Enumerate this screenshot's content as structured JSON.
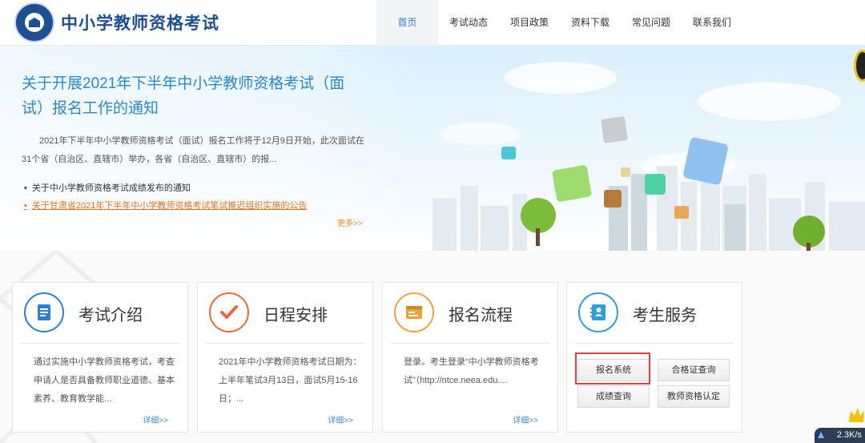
{
  "header": {
    "site_title": "中小学教师资格考试",
    "logo_icon": "exam-emblem-icon",
    "nav": [
      "首页",
      "考试动态",
      "项目政策",
      "资料下载",
      "常见问题",
      "联系我们"
    ],
    "active_nav": "首页"
  },
  "banner": {
    "title": "关于开展2021年下半年中小学教师资格考试（面试）报名工作的通知",
    "description": "2021年下半年中小学教师资格考试（面试）报名工作将于12月9日开始，此次面试在31个省（自治区、直辖市）举办，各省（自治区、直辖市）的报...",
    "news": [
      "关于中小学教师资格考试成绩发布的通知",
      "关于甘肃省2021年下半年中小学教师资格考试笔试推迟组织实施的公告"
    ],
    "more": "更多>>"
  },
  "cards": [
    {
      "title": "考试介绍",
      "icon": "document-icon",
      "text": "通过实施中小学教师资格考试，考查申请人是否具备教师职业道德、基本素养、教育教学能...",
      "more": "详细>>"
    },
    {
      "title": "日程安排",
      "icon": "checkmark-icon",
      "text": "2021年中小学教师资格考试日期为：上半年笔试3月13日，面试5月15-16日；...",
      "more": "详细>>"
    },
    {
      "title": "报名流程",
      "icon": "form-icon",
      "text": "登录。考生登录“中小学教师资格考试”（http://ntce.neea.edu....",
      "more": "详细>>"
    },
    {
      "title": "考生服务",
      "icon": "contact-book-icon"
    }
  ],
  "services": [
    "报名系统",
    "合格证查询",
    "成绩查询",
    "教师资格认定"
  ],
  "speed_widget": "2.3K/s",
  "colors": {
    "primary_blue": "#1f4f93",
    "accent_blue": "#2a88cf",
    "highlight_orange": "#e8731a",
    "selection_red": "#e04040"
  }
}
